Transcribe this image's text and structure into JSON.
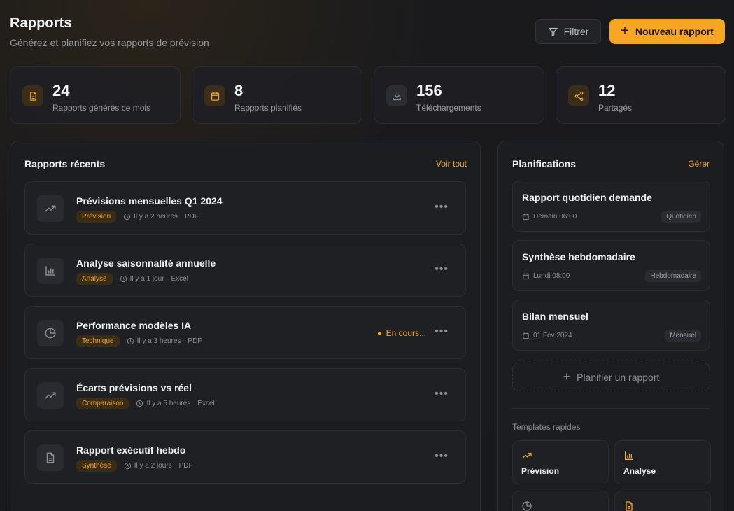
{
  "header": {
    "title": "Rapports",
    "subtitle": "Générez et planifiez vos rapports de prévision",
    "filter_label": "Filtrer",
    "new_label": "Nouveau rapport"
  },
  "stats": [
    {
      "value": "24",
      "label": "Rapports générés ce mois",
      "icon": "file-text-icon"
    },
    {
      "value": "8",
      "label": "Rapports planifiés",
      "icon": "calendar-icon"
    },
    {
      "value": "156",
      "label": "Téléchargements",
      "icon": "download-icon"
    },
    {
      "value": "12",
      "label": "Partagés",
      "icon": "share-icon"
    }
  ],
  "recent": {
    "title": "Rapports récents",
    "link": "Voir tout",
    "items": [
      {
        "name": "Prévisions mensuelles Q1 2024",
        "tag": "Prévision",
        "time": "Il y a 2 heures",
        "format": "PDF",
        "icon": "trending-up-icon",
        "status": ""
      },
      {
        "name": "Analyse saisonnalité annuelle",
        "tag": "Analyse",
        "time": "Il y a 1 jour",
        "format": "Excel",
        "icon": "bar-chart-icon",
        "status": ""
      },
      {
        "name": "Performance modèles IA",
        "tag": "Technique",
        "time": "Il y a 3 heures",
        "format": "PDF",
        "icon": "pie-chart-icon",
        "status": "En cours..."
      },
      {
        "name": "Écarts prévisions vs réel",
        "tag": "Comparaison",
        "time": "Il y a 5 heures",
        "format": "Excel",
        "icon": "trending-up-icon",
        "status": ""
      },
      {
        "name": "Rapport exécutif hebdo",
        "tag": "Synthèse",
        "time": "Il y a 2 jours",
        "format": "PDF",
        "icon": "file-text-icon",
        "status": ""
      }
    ]
  },
  "schedules": {
    "title": "Planifications",
    "link": "Gérer",
    "items": [
      {
        "name": "Rapport quotidien demande",
        "time": "Demain 06:00",
        "badge": "Quotidien"
      },
      {
        "name": "Synthèse hebdomadaire",
        "time": "Lundi 08:00",
        "badge": "Hebdomadaire"
      },
      {
        "name": "Bilan mensuel",
        "time": "01 Fév 2024",
        "badge": "Mensuel"
      }
    ],
    "add_label": "Planifier un rapport"
  },
  "templates": {
    "title": "Templates rapides",
    "items": [
      {
        "label": "Prévision",
        "icon": "trending-up-icon"
      },
      {
        "label": "Analyse",
        "icon": "bar-chart-icon"
      },
      {
        "label": "",
        "icon": "pie-chart-icon"
      },
      {
        "label": "",
        "icon": "file-text-icon"
      }
    ]
  },
  "colors": {
    "accent": "#f5a623",
    "background": "#18191d",
    "card": "#1f2024"
  }
}
